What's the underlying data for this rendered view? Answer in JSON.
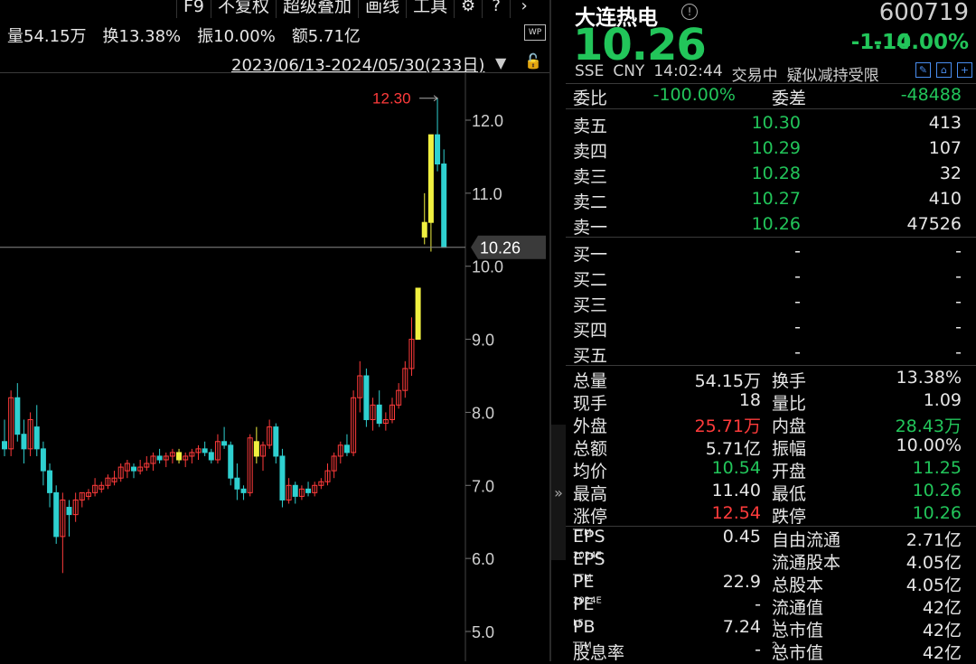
{
  "toolbar": {
    "items": [
      "F9",
      "不复权",
      "超级叠加",
      "画线",
      "工具"
    ],
    "icons": [
      "gear-icon",
      "help-icon",
      "chevron-right-icon"
    ]
  },
  "stats": {
    "volume": "量54.15万",
    "turnover": "换13.38%",
    "amplitude": "振10.00%",
    "amount": "额5.71亿"
  },
  "wp_label": "WP",
  "range_label": "2023/06/13-2024/05/30(233日)",
  "chart_data": {
    "type": "candlestick",
    "y_ticks": [
      12.0,
      11.0,
      10.0,
      9.0,
      8.0,
      7.0,
      6.0,
      5.0
    ],
    "y_tick_labels": [
      "12.0",
      "11.0",
      "10.0",
      "9.0",
      "8.0",
      "7.0",
      "6.0",
      "5.0"
    ],
    "ylim": [
      4.7,
      12.75
    ],
    "high_label": "12.30",
    "high_value": 12.3,
    "current_label": "10.26",
    "current_value": 10.26,
    "candles": [
      [
        7.6,
        7.9,
        7.4,
        7.5
      ],
      [
        7.5,
        8.3,
        7.4,
        8.2
      ],
      [
        8.2,
        8.4,
        7.6,
        7.7
      ],
      [
        7.7,
        7.9,
        7.3,
        7.5
      ],
      [
        7.5,
        8.0,
        7.4,
        7.9
      ],
      [
        7.8,
        8.1,
        7.4,
        7.5
      ],
      [
        7.5,
        7.6,
        7.0,
        7.2
      ],
      [
        7.2,
        7.3,
        6.7,
        6.9
      ],
      [
        6.9,
        7.0,
        6.2,
        6.3
      ],
      [
        6.3,
        6.9,
        5.8,
        6.8
      ],
      [
        6.7,
        6.8,
        6.3,
        6.6
      ],
      [
        6.6,
        6.9,
        6.5,
        6.8
      ],
      [
        6.8,
        6.9,
        6.7,
        6.9
      ],
      [
        6.85,
        6.95,
        6.8,
        6.9
      ],
      [
        6.9,
        7.1,
        6.85,
        7.0
      ],
      [
        6.95,
        7.05,
        6.9,
        7.0
      ],
      [
        7.0,
        7.15,
        6.95,
        7.1
      ],
      [
        7.05,
        7.2,
        7.0,
        7.1
      ],
      [
        7.1,
        7.3,
        7.05,
        7.25
      ],
      [
        7.2,
        7.35,
        7.1,
        7.3
      ],
      [
        7.25,
        7.3,
        7.1,
        7.2
      ],
      [
        7.2,
        7.35,
        7.15,
        7.25
      ],
      [
        7.25,
        7.4,
        7.2,
        7.3
      ],
      [
        7.3,
        7.45,
        7.2,
        7.4
      ],
      [
        7.4,
        7.5,
        7.3,
        7.35
      ],
      [
        7.35,
        7.45,
        7.25,
        7.4
      ],
      [
        7.4,
        7.5,
        7.3,
        7.45
      ],
      [
        7.45,
        7.5,
        7.3,
        7.35
      ],
      [
        7.35,
        7.45,
        7.25,
        7.4
      ],
      [
        7.4,
        7.5,
        7.3,
        7.45
      ],
      [
        7.45,
        7.55,
        7.35,
        7.5
      ],
      [
        7.5,
        7.6,
        7.4,
        7.45
      ],
      [
        7.45,
        7.5,
        7.3,
        7.35
      ],
      [
        7.35,
        7.7,
        7.3,
        7.6
      ],
      [
        7.6,
        7.8,
        7.5,
        7.55
      ],
      [
        7.55,
        7.6,
        7.0,
        7.1
      ],
      [
        7.1,
        7.3,
        6.8,
        6.95
      ],
      [
        6.95,
        7.0,
        6.8,
        6.9
      ],
      [
        6.9,
        7.7,
        6.85,
        7.65
      ],
      [
        7.6,
        7.8,
        7.3,
        7.4
      ],
      [
        7.4,
        7.6,
        7.2,
        7.55
      ],
      [
        7.55,
        7.9,
        7.5,
        7.8
      ],
      [
        7.8,
        7.85,
        7.3,
        7.4
      ],
      [
        7.4,
        7.5,
        6.7,
        6.8
      ],
      [
        6.8,
        7.1,
        6.75,
        7.0
      ],
      [
        7.0,
        7.05,
        6.75,
        6.85
      ],
      [
        6.85,
        7.0,
        6.8,
        6.95
      ],
      [
        6.95,
        7.05,
        6.85,
        6.9
      ],
      [
        6.9,
        7.05,
        6.85,
        7.0
      ],
      [
        7.0,
        7.1,
        6.95,
        7.05
      ],
      [
        7.05,
        7.3,
        7.0,
        7.2
      ],
      [
        7.2,
        7.45,
        7.1,
        7.4
      ],
      [
        7.4,
        7.6,
        7.3,
        7.55
      ],
      [
        7.55,
        7.7,
        7.4,
        7.45
      ],
      [
        7.45,
        8.3,
        7.4,
        8.2
      ],
      [
        8.2,
        8.7,
        8.0,
        8.5
      ],
      [
        8.5,
        8.6,
        7.8,
        7.9
      ],
      [
        7.9,
        8.2,
        7.75,
        8.1
      ],
      [
        8.1,
        8.3,
        7.8,
        7.85
      ],
      [
        7.85,
        8.0,
        7.75,
        7.9
      ],
      [
        7.9,
        8.2,
        7.85,
        8.1
      ],
      [
        8.1,
        8.4,
        8.05,
        8.3
      ],
      [
        8.3,
        8.7,
        8.2,
        8.6
      ],
      [
        8.6,
        9.3,
        8.5,
        9.0
      ],
      [
        9.0,
        9.7,
        9.0,
        9.7
      ],
      [
        10.4,
        11.0,
        10.3,
        10.6
      ],
      [
        10.6,
        11.8,
        10.2,
        11.8
      ],
      [
        11.8,
        12.3,
        11.3,
        11.4
      ],
      [
        11.4,
        11.6,
        10.26,
        10.26
      ]
    ],
    "highlight_candles": [
      27,
      39,
      64,
      65,
      66
    ]
  },
  "collapse_icon": "double-chevron-right-icon",
  "quote": {
    "name": "大连热电",
    "code": "600719",
    "price": "10.26",
    "change": "-1.14",
    "change_pct": "-10.00%",
    "exchange": "SSE",
    "currency": "CNY",
    "time": "14:02:44",
    "status": "交易中",
    "note": "疑似减持受限"
  },
  "weibi": {
    "label": "委比",
    "value": "-100.00%",
    "diff_label": "委差",
    "diff_value": "-48488"
  },
  "asks": [
    {
      "label": "卖五",
      "price": "10.30",
      "vol": "413"
    },
    {
      "label": "卖四",
      "price": "10.29",
      "vol": "107"
    },
    {
      "label": "卖三",
      "price": "10.28",
      "vol": "32"
    },
    {
      "label": "卖二",
      "price": "10.27",
      "vol": "410"
    },
    {
      "label": "卖一",
      "price": "10.26",
      "vol": "47526"
    }
  ],
  "bids": [
    {
      "label": "买一",
      "price": "-",
      "vol": "-"
    },
    {
      "label": "买二",
      "price": "-",
      "vol": "-"
    },
    {
      "label": "买三",
      "price": "-",
      "vol": "-"
    },
    {
      "label": "买四",
      "price": "-",
      "vol": "-"
    },
    {
      "label": "买五",
      "price": "-",
      "vol": "-"
    }
  ],
  "stats_table": [
    {
      "l1": "总量",
      "v1": "54.15万",
      "c1": "w",
      "l2": "换手",
      "v2": "13.38%",
      "c2": "w"
    },
    {
      "l1": "现手",
      "v1": "18",
      "c1": "w",
      "l2": "量比",
      "v2": "1.09",
      "c2": "w"
    },
    {
      "l1": "外盘",
      "v1": "25.71万",
      "c1": "r",
      "l2": "内盘",
      "v2": "28.43万",
      "c2": "g"
    },
    {
      "l1": "总额",
      "v1": "5.71亿",
      "c1": "w",
      "l2": "振幅",
      "v2": "10.00%",
      "c2": "w"
    },
    {
      "l1": "均价",
      "v1": "10.54",
      "c1": "g",
      "l2": "开盘",
      "v2": "11.25",
      "c2": "g"
    },
    {
      "l1": "最高",
      "v1": "11.40",
      "c1": "w",
      "l2": "最低",
      "v2": "10.26",
      "c2": "g"
    },
    {
      "l1": "涨停",
      "v1": "12.54",
      "c1": "r",
      "l2": "跌停",
      "v2": "10.26",
      "c2": "g"
    }
  ],
  "fin_table": [
    {
      "l1": "EPS",
      "s1": "TTM",
      "v1": "0.45",
      "l2": "自由流通",
      "s2": "",
      "v2": "2.71亿"
    },
    {
      "l1": "EPS",
      "s1": "2024E",
      "v1": "",
      "l2": "流通股本",
      "s2": "",
      "v2": "4.05亿"
    },
    {
      "l1": "PE",
      "s1": "TTM",
      "v1": "22.9",
      "l2": "总股本",
      "s2": "",
      "v2": "4.05亿"
    },
    {
      "l1": "PE",
      "s1": "2024E",
      "v1": "-",
      "l2": "流通值",
      "s2": "",
      "v2": "42亿"
    },
    {
      "l1": "PB",
      "s1": "LF",
      "v1": "7.24",
      "l2": "总市值",
      "s2": "1",
      "v2": "42亿"
    },
    {
      "l1": "股息率",
      "s1": "TTM",
      "v1": "-",
      "l2": "总市值",
      "s2": "2",
      "v2": "42亿"
    }
  ],
  "colors": {
    "up": "#ff3b3b",
    "down": "#22c55a",
    "candle_down": "#2fd0d0",
    "highlight": "#f0f040",
    "text": "#e6e6e6"
  }
}
